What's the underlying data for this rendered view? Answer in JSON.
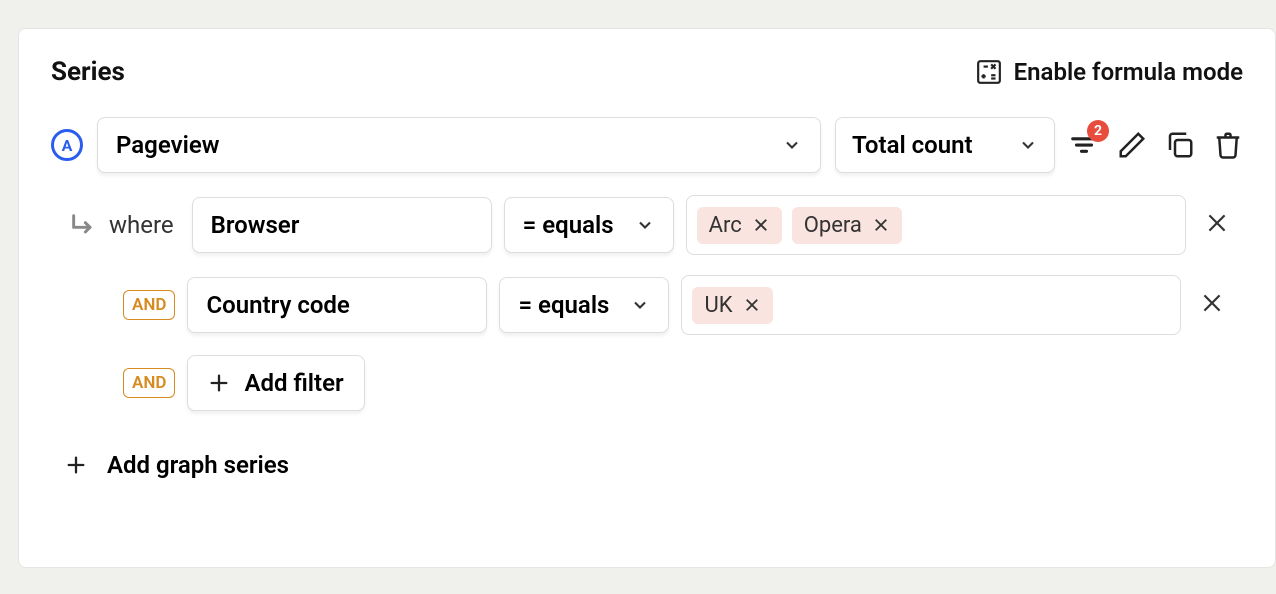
{
  "header": {
    "title": "Series",
    "formula_label": "Enable formula mode"
  },
  "series": {
    "badge": "A",
    "event_label": "Pageview",
    "aggregation_label": "Total count",
    "filter_count": "2"
  },
  "filters": {
    "where_label": "where",
    "and_label": "AND",
    "rows": [
      {
        "property": "Browser",
        "operator": "= equals",
        "values": [
          "Arc",
          "Opera"
        ]
      },
      {
        "property": "Country code",
        "operator": "= equals",
        "values": [
          "UK"
        ]
      }
    ],
    "add_filter_label": "Add filter"
  },
  "add_series_label": "Add graph series"
}
